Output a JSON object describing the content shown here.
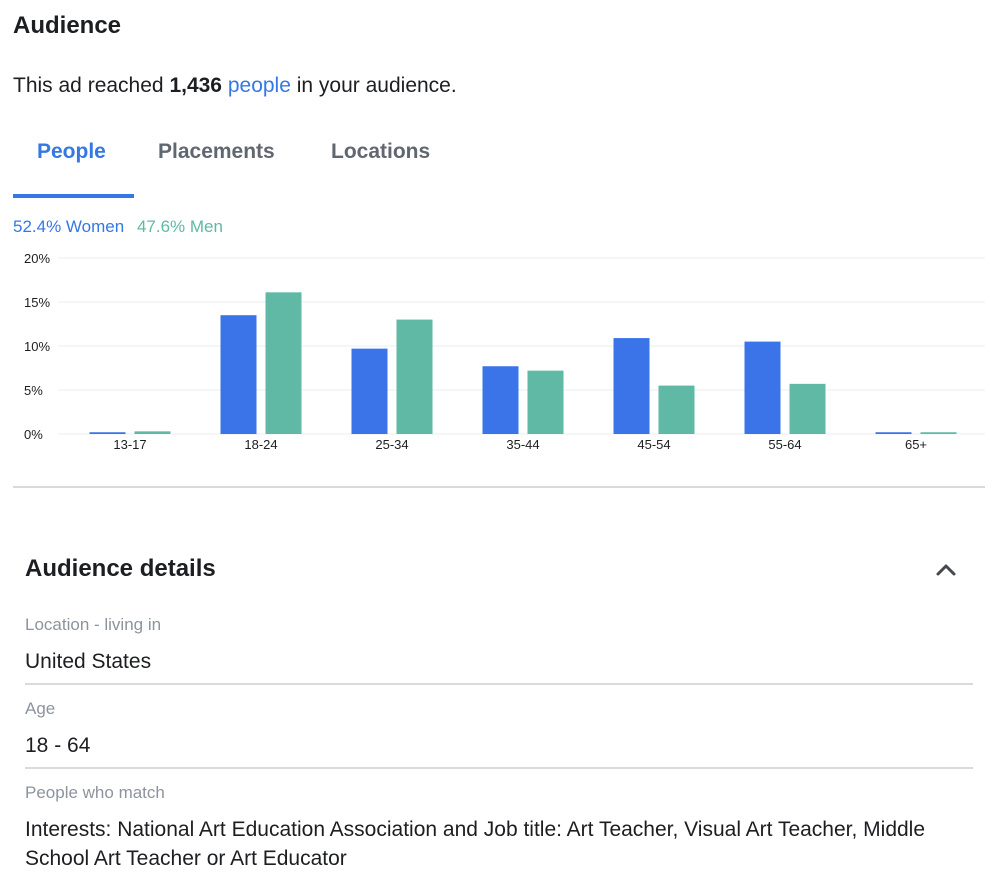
{
  "header": {
    "title": "Audience",
    "reach_prefix": "This ad reached",
    "reach_count": "1,436",
    "reach_link": "people",
    "reach_suffix": "in your audience."
  },
  "tabs": [
    {
      "label": "People",
      "active": true
    },
    {
      "label": "Placements",
      "active": false
    },
    {
      "label": "Locations",
      "active": false
    }
  ],
  "gender": {
    "women_label": "52.4% Women",
    "men_label": "47.6% Men"
  },
  "colors": {
    "accent": "#3578e5",
    "women_bar": "#3a74e8",
    "men_bar": "#5fb9a4",
    "divider": "#d8dadd"
  },
  "chart_data": {
    "type": "bar",
    "categories": [
      "13-17",
      "18-24",
      "25-34",
      "35-44",
      "45-54",
      "55-64",
      "65+"
    ],
    "series": [
      {
        "name": "Women",
        "values": [
          0.2,
          13.5,
          9.7,
          7.7,
          10.9,
          10.5,
          0.2
        ]
      },
      {
        "name": "Men",
        "values": [
          0.3,
          16.1,
          13.0,
          7.2,
          5.5,
          5.7,
          0.2
        ]
      }
    ],
    "yticks": [
      "0%",
      "5%",
      "10%",
      "15%",
      "20%"
    ],
    "ylim": [
      0,
      20
    ],
    "grid": true
  },
  "details": {
    "title": "Audience details",
    "collapse_icon": "chevron-up-icon",
    "items": [
      {
        "label": "Location - living in",
        "value": "United States"
      },
      {
        "label": "Age",
        "value": "18 - 64"
      },
      {
        "label": "People who match",
        "value": "Interests: National Art Education Association and Job title: Art Teacher, Visual Art Teacher, Middle School Art Teacher or Art Educator"
      }
    ]
  }
}
